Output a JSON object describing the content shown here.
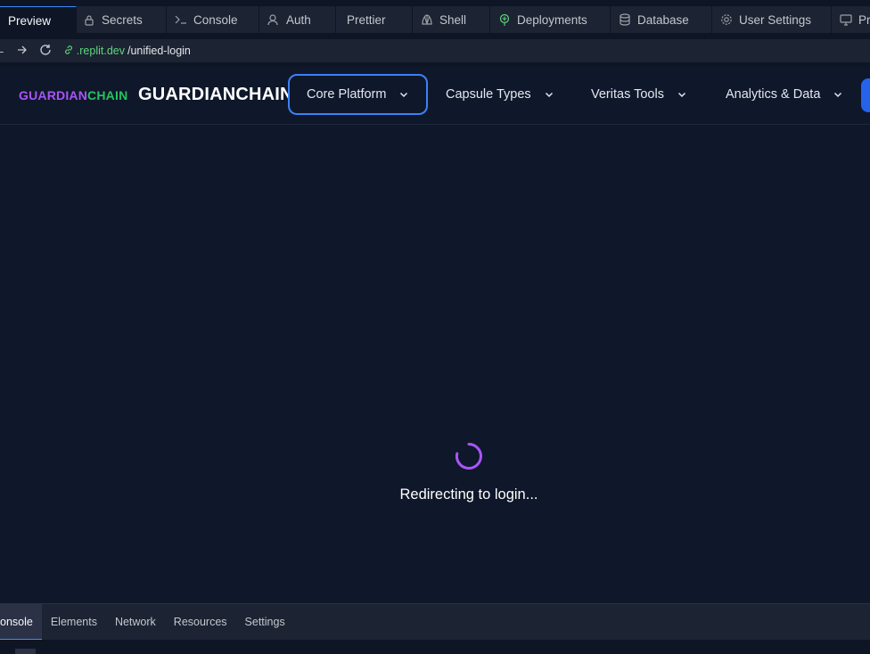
{
  "tabs": [
    {
      "label": "Preview",
      "icon": "preview-icon",
      "active": true
    },
    {
      "label": "Secrets",
      "icon": "lock-icon"
    },
    {
      "label": "Console",
      "icon": "terminal-icon"
    },
    {
      "label": "Auth",
      "icon": "user-icon"
    },
    {
      "label": "Prettier",
      "icon": "prettier-icon"
    },
    {
      "label": "Shell",
      "icon": "shell-icon"
    },
    {
      "label": "Deployments",
      "icon": "deployments-icon"
    },
    {
      "label": "Database",
      "icon": "database-icon"
    },
    {
      "label": "User Settings",
      "icon": "gear-icon"
    },
    {
      "label": "Pr",
      "icon": "monitor-icon"
    }
  ],
  "urlbar": {
    "host": ".replit.dev",
    "path": "/unified-login"
  },
  "app": {
    "logo_small_a": "GUARDIAN",
    "logo_small_b": "CHAIN",
    "logo_big": "GUARDIANCHAIN",
    "menu": [
      {
        "label": "Core Platform"
      },
      {
        "label": "Capsule Types"
      },
      {
        "label": "Veritas Tools"
      },
      {
        "label": "Analytics & Data"
      }
    ],
    "status": "Redirecting to login..."
  },
  "devtools": {
    "tabs": [
      "onsole",
      "Elements",
      "Network",
      "Resources",
      "Settings"
    ]
  },
  "colors": {
    "accent": "#3b82f6",
    "spinner": "#a855f7",
    "logo_purple": "#a855f7",
    "logo_green": "#22c55e"
  }
}
